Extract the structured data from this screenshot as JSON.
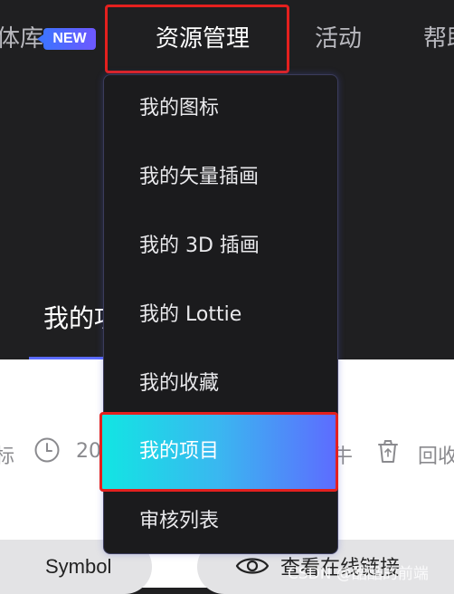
{
  "topnav": {
    "items": [
      {
        "label": "体库"
      },
      {
        "label": "资源管理"
      },
      {
        "label": "活动"
      },
      {
        "label": "帮助"
      }
    ],
    "badge": "NEW"
  },
  "tab": {
    "label": "我的项"
  },
  "toolbar": {
    "left_fragment": "标",
    "date_fragment": "20",
    "right_fragment": "牛",
    "recycle_label": "回收"
  },
  "bottom": {
    "symbol_label": "Symbol",
    "view_label": "查看在线链接",
    "watermark": "CSDN @酷酷的前端"
  },
  "dropdown": {
    "items": [
      {
        "label": "我的图标"
      },
      {
        "label": "我的矢量插画"
      },
      {
        "label": "我的 3D 插画"
      },
      {
        "label": "我的 Lottie"
      },
      {
        "label": "我的收藏"
      },
      {
        "label": "我的项目"
      },
      {
        "label": "审核列表"
      }
    ],
    "active_index": 5
  },
  "colors": {
    "highlight_red": "#e4201e",
    "accent_gradient_start": "#12e5e3",
    "accent_gradient_end": "#5d6cff",
    "dark_bg": "#1f1f21"
  }
}
